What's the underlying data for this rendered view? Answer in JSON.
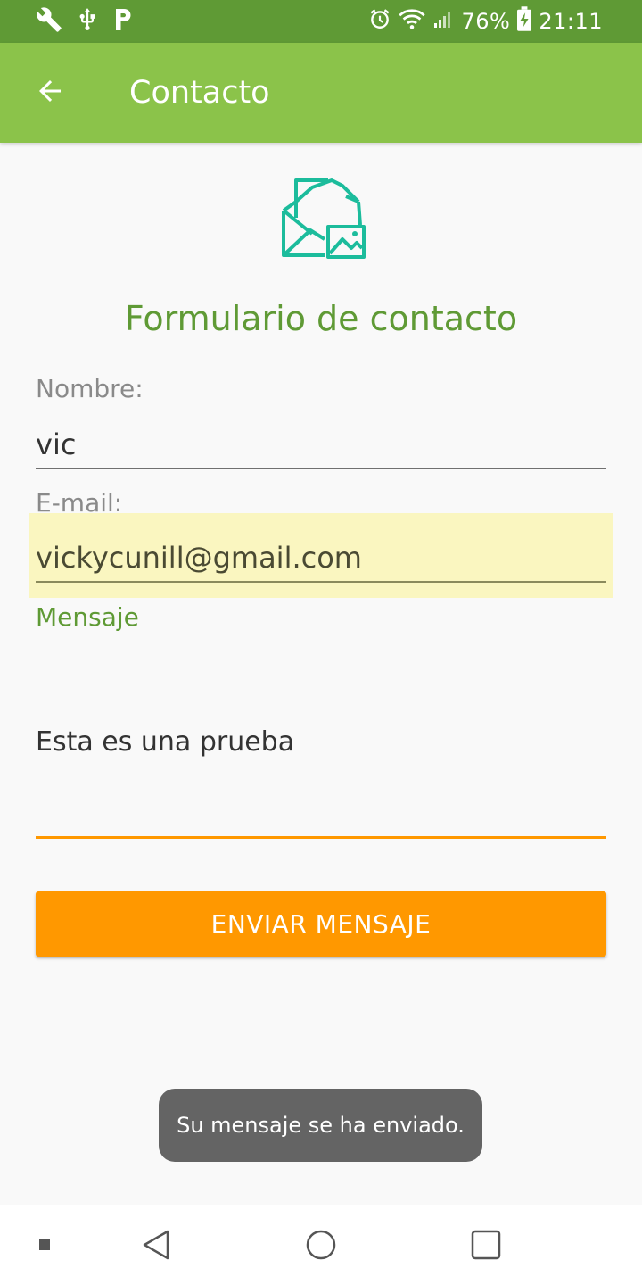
{
  "status_bar": {
    "battery": "76%",
    "time": "21:11",
    "icons": [
      "wrench-icon",
      "usb-icon",
      "parking-icon",
      "alarm-icon",
      "wifi-icon",
      "signal-icon",
      "battery-charging-icon"
    ]
  },
  "app_bar": {
    "title": "Contacto",
    "back_icon": "arrow-back-icon"
  },
  "hero": {
    "icon": "mail-image-icon"
  },
  "form": {
    "title": "Formulario de contacto",
    "name_label": "Nombre:",
    "name_value": "vic",
    "email_label": "E-mail:",
    "email_value": "vickycunill@gmail.com",
    "message_label": "Mensaje",
    "message_value": "Esta es una prueba",
    "send_label": "ENVIAR MENSAJE"
  },
  "toast": {
    "text": "Su mensaje se ha enviado."
  },
  "nav": {
    "icons": [
      "recents-square-small-icon",
      "back-triangle-icon",
      "home-circle-icon",
      "overview-square-icon"
    ]
  },
  "colors": {
    "status_bar": "#5f9a35",
    "app_bar": "#8bc34a",
    "accent_orange": "#ff9800",
    "title_green": "#5f9a35",
    "hero_teal": "#1cbc9c",
    "autofill": "#faf6c0"
  }
}
